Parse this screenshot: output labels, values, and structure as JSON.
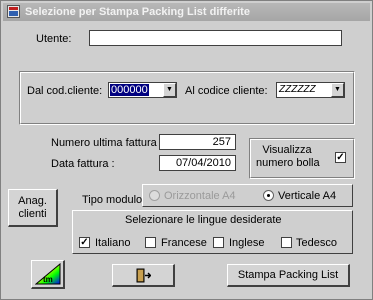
{
  "window": {
    "title": "Selezione per Stampa Packing List differite"
  },
  "utente": {
    "label": "Utente:",
    "value": ""
  },
  "cliente": {
    "dal_label": "Dal cod.cliente:",
    "dal_value": "000000",
    "al_label": "Al codice cliente:",
    "al_value": "ZZZZZZ"
  },
  "fattura": {
    "numero_label": "Numero ultima fattura :",
    "numero_value": "257",
    "data_label": "Data fattura :",
    "data_value": "07/04/2010"
  },
  "visualizza": {
    "label_line1": "Visualizza",
    "label_line2": "numero bolla",
    "checked": true
  },
  "anag_button": {
    "line1": "Anag.",
    "line2": "clienti"
  },
  "tipo_modulo": {
    "label": "Tipo modulo",
    "options": [
      "Orizzontale A4",
      "Verticale A4"
    ],
    "selected": "Verticale A4"
  },
  "lingue": {
    "title": "Selezionare le lingue desiderate",
    "items": [
      {
        "label": "Italiano",
        "checked": true
      },
      {
        "label": "Francese",
        "checked": false
      },
      {
        "label": "Inglese",
        "checked": false
      },
      {
        "label": "Tedesco",
        "checked": false
      }
    ]
  },
  "buttons": {
    "stampa": "Stampa Packing List",
    "logo_text": "tm"
  },
  "icons": {
    "app": "app-icon",
    "exit": "exit-door-icon",
    "logo": "brand-logo-icon"
  }
}
